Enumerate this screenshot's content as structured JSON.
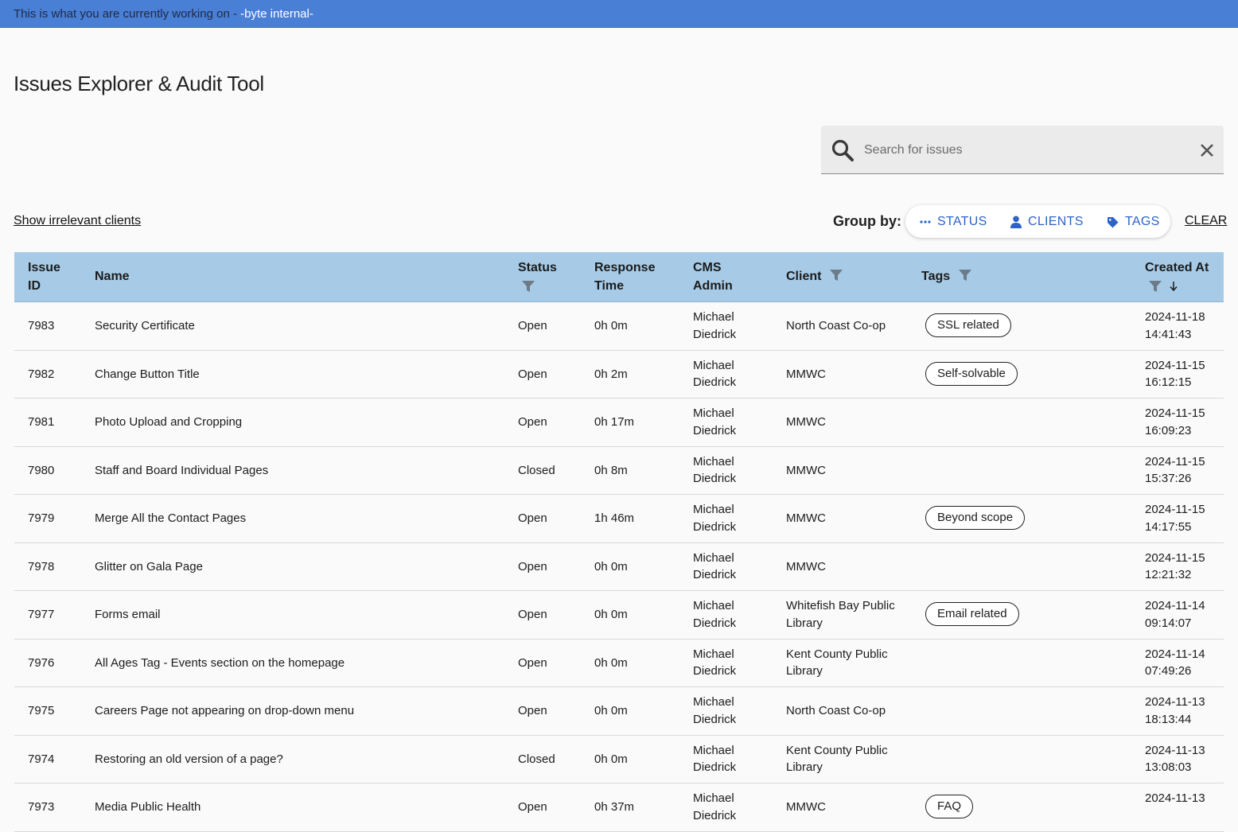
{
  "banner": {
    "prefix": "This is what you are currently working on - ",
    "project": "-byte internal-"
  },
  "page": {
    "title": "Issues Explorer & Audit Tool"
  },
  "search": {
    "placeholder": "Search for issues"
  },
  "filters": {
    "show_irrelevant_label": "Show irrelevant clients",
    "group_by_label": "Group by:",
    "group_options": [
      "STATUS",
      "CLIENTS",
      "TAGS"
    ],
    "clear_label": "CLEAR"
  },
  "table": {
    "columns": {
      "issue_id": [
        "Issue",
        "ID"
      ],
      "name": "Name",
      "status": "Status",
      "response_time": [
        "Response",
        "Time"
      ],
      "cms_admin": [
        "CMS",
        "Admin"
      ],
      "client": "Client",
      "tags": "Tags",
      "created_at": "Created At"
    },
    "rows": [
      {
        "id": "7983",
        "name": "Security Certificate",
        "status": "Open",
        "response": "0h 0m",
        "admin": [
          "Michael",
          "Diedrick"
        ],
        "client": [
          "North Coast Co-op"
        ],
        "tag": "SSL related",
        "date": "2024-11-18",
        "time": "14:41:43"
      },
      {
        "id": "7982",
        "name": "Change Button Title",
        "status": "Open",
        "response": "0h 2m",
        "admin": [
          "Michael",
          "Diedrick"
        ],
        "client": [
          "MMWC"
        ],
        "tag": "Self-solvable",
        "date": "2024-11-15",
        "time": "16:12:15"
      },
      {
        "id": "7981",
        "name": "Photo Upload and Cropping",
        "status": "Open",
        "response": "0h 17m",
        "admin": [
          "Michael",
          "Diedrick"
        ],
        "client": [
          "MMWC"
        ],
        "tag": "",
        "date": "2024-11-15",
        "time": "16:09:23"
      },
      {
        "id": "7980",
        "name": "Staff and Board Individual Pages",
        "status": "Closed",
        "response": "0h 8m",
        "admin": [
          "Michael",
          "Diedrick"
        ],
        "client": [
          "MMWC"
        ],
        "tag": "",
        "date": "2024-11-15",
        "time": "15:37:26"
      },
      {
        "id": "7979",
        "name": "Merge All the Contact Pages",
        "status": "Open",
        "response": "1h 46m",
        "admin": [
          "Michael",
          "Diedrick"
        ],
        "client": [
          "MMWC"
        ],
        "tag": "Beyond scope",
        "date": "2024-11-15",
        "time": "14:17:55"
      },
      {
        "id": "7978",
        "name": "Glitter on Gala Page",
        "status": "Open",
        "response": "0h 0m",
        "admin": [
          "Michael",
          "Diedrick"
        ],
        "client": [
          "MMWC"
        ],
        "tag": "",
        "date": "2024-11-15",
        "time": "12:21:32"
      },
      {
        "id": "7977",
        "name": "Forms email",
        "status": "Open",
        "response": "0h 0m",
        "admin": [
          "Michael",
          "Diedrick"
        ],
        "client": [
          "Whitefish Bay Public",
          "Library"
        ],
        "tag": "Email related",
        "date": "2024-11-14",
        "time": "09:14:07"
      },
      {
        "id": "7976",
        "name": "All Ages Tag - Events section on the homepage",
        "status": "Open",
        "response": "0h 0m",
        "admin": [
          "Michael",
          "Diedrick"
        ],
        "client": [
          "Kent County Public",
          "Library"
        ],
        "tag": "",
        "date": "2024-11-14",
        "time": "07:49:26"
      },
      {
        "id": "7975",
        "name": "Careers Page not appearing on drop-down menu",
        "status": "Open",
        "response": "0h 0m",
        "admin": [
          "Michael",
          "Diedrick"
        ],
        "client": [
          "North Coast Co-op"
        ],
        "tag": "",
        "date": "2024-11-13",
        "time": "18:13:44"
      },
      {
        "id": "7974",
        "name": "Restoring an old version of a page?",
        "status": "Closed",
        "response": "0h 0m",
        "admin": [
          "Michael",
          "Diedrick"
        ],
        "client": [
          "Kent County Public",
          "Library"
        ],
        "tag": "",
        "date": "2024-11-13",
        "time": "13:08:03"
      },
      {
        "id": "7973",
        "name": "Media Public Health",
        "status": "Open",
        "response": "0h 37m",
        "admin": [
          "Michael",
          "Diedrick"
        ],
        "client": [
          "MMWC"
        ],
        "tag": "FAQ",
        "date": "2024-11-13",
        "time": ""
      }
    ]
  },
  "colors": {
    "banner": "#4a7fd6",
    "table_header": "#a7cbe6",
    "accent": "#2d63c8"
  },
  "icons": [
    "search-icon",
    "close-icon",
    "more-horizontal-icon",
    "person-icon",
    "tag-icon",
    "filter-icon",
    "arrow-down-icon"
  ]
}
